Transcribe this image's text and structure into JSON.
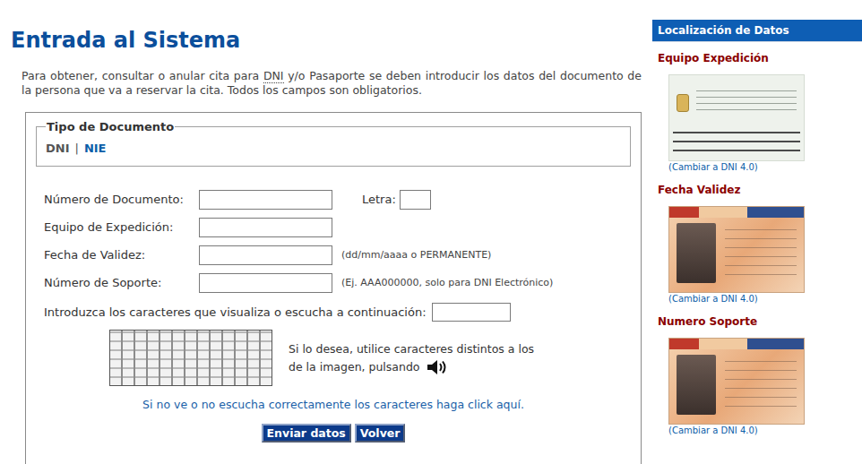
{
  "page": {
    "title": "Entrada al Sistema",
    "intro_before": "Para obtener, consultar o anular cita para ",
    "intro_abbr": "DNI",
    "intro_after": " y/o Pasaporte se deben introducir los datos del documento de la persona que va a reservar la cita. Todos los campos son obligatorios."
  },
  "document_type": {
    "legend": "Tipo de Documento",
    "separator": "|",
    "options": [
      {
        "label": "DNI",
        "selected": true
      },
      {
        "label": "NIE",
        "selected": false
      }
    ]
  },
  "fields": [
    {
      "label": "Número de Documento:",
      "value": "",
      "hint": "",
      "extra": {
        "label": "Letra:",
        "value": ""
      }
    },
    {
      "label": "Equipo de Expedición:",
      "value": "",
      "hint": "",
      "extra": null
    },
    {
      "label": "Fecha de Validez:",
      "value": "",
      "hint": "(dd/mm/aaaa o PERMANENTE)",
      "extra": null
    },
    {
      "label": "Número de Soporte:",
      "value": "",
      "hint": "(Ej. AAA000000, solo para DNI Electrónico)",
      "extra": null
    }
  ],
  "captcha": {
    "label": "Introduzca los caracteres que visualiza o escucha a continuación:",
    "value": "",
    "audio_lines": [
      "Si lo desea, utilice caracteres distintos a los",
      "de la imagen, pulsando"
    ],
    "help_link": "Si no ve o no escucha correctamente los caracteres haga click aquí."
  },
  "buttons": [
    "Enviar datos",
    "Volver"
  ],
  "sidebar": {
    "title": "Localización de Datos",
    "sections": [
      {
        "heading": "Equipo Expedición",
        "kind": "card-back",
        "link": "(Cambiar a DNI 4.0)"
      },
      {
        "heading": "Fecha Validez",
        "kind": "card-front",
        "link": "(Cambiar a DNI 4.0)"
      },
      {
        "heading": "Numero Soporte",
        "kind": "card-front",
        "link": "(Cambiar a DNI 4.0)"
      }
    ]
  }
}
